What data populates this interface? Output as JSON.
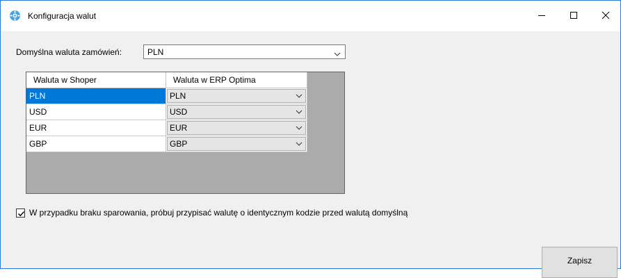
{
  "window": {
    "title": "Konfiguracja walut",
    "app_icon": "gear-icon",
    "controls": {
      "minimize": "minimize-icon",
      "maximize": "maximize-icon",
      "close": "close-icon"
    }
  },
  "default_currency": {
    "label": "Domyślna waluta zamówień:",
    "value": "PLN"
  },
  "grid": {
    "columns": [
      "Waluta w Shoper",
      "Waluta w ERP Optima"
    ],
    "rows": [
      {
        "shoper": "PLN",
        "erp": "PLN",
        "selected": true
      },
      {
        "shoper": "USD",
        "erp": "USD",
        "selected": false
      },
      {
        "shoper": "EUR",
        "erp": "EUR",
        "selected": false
      },
      {
        "shoper": "GBP",
        "erp": "GBP",
        "selected": false
      }
    ]
  },
  "fallback_option": {
    "checked": true,
    "label": "W przypadku braku sparowania, próbuj przypisać walutę o identycznym kodzie przed walutą domyślną"
  },
  "save_button": {
    "label": "Zapisz"
  },
  "colors": {
    "selection": "#0078d7",
    "grid_background": "#ababab",
    "window_background": "#f0f0f0",
    "window_border": "#2b7bd3"
  }
}
